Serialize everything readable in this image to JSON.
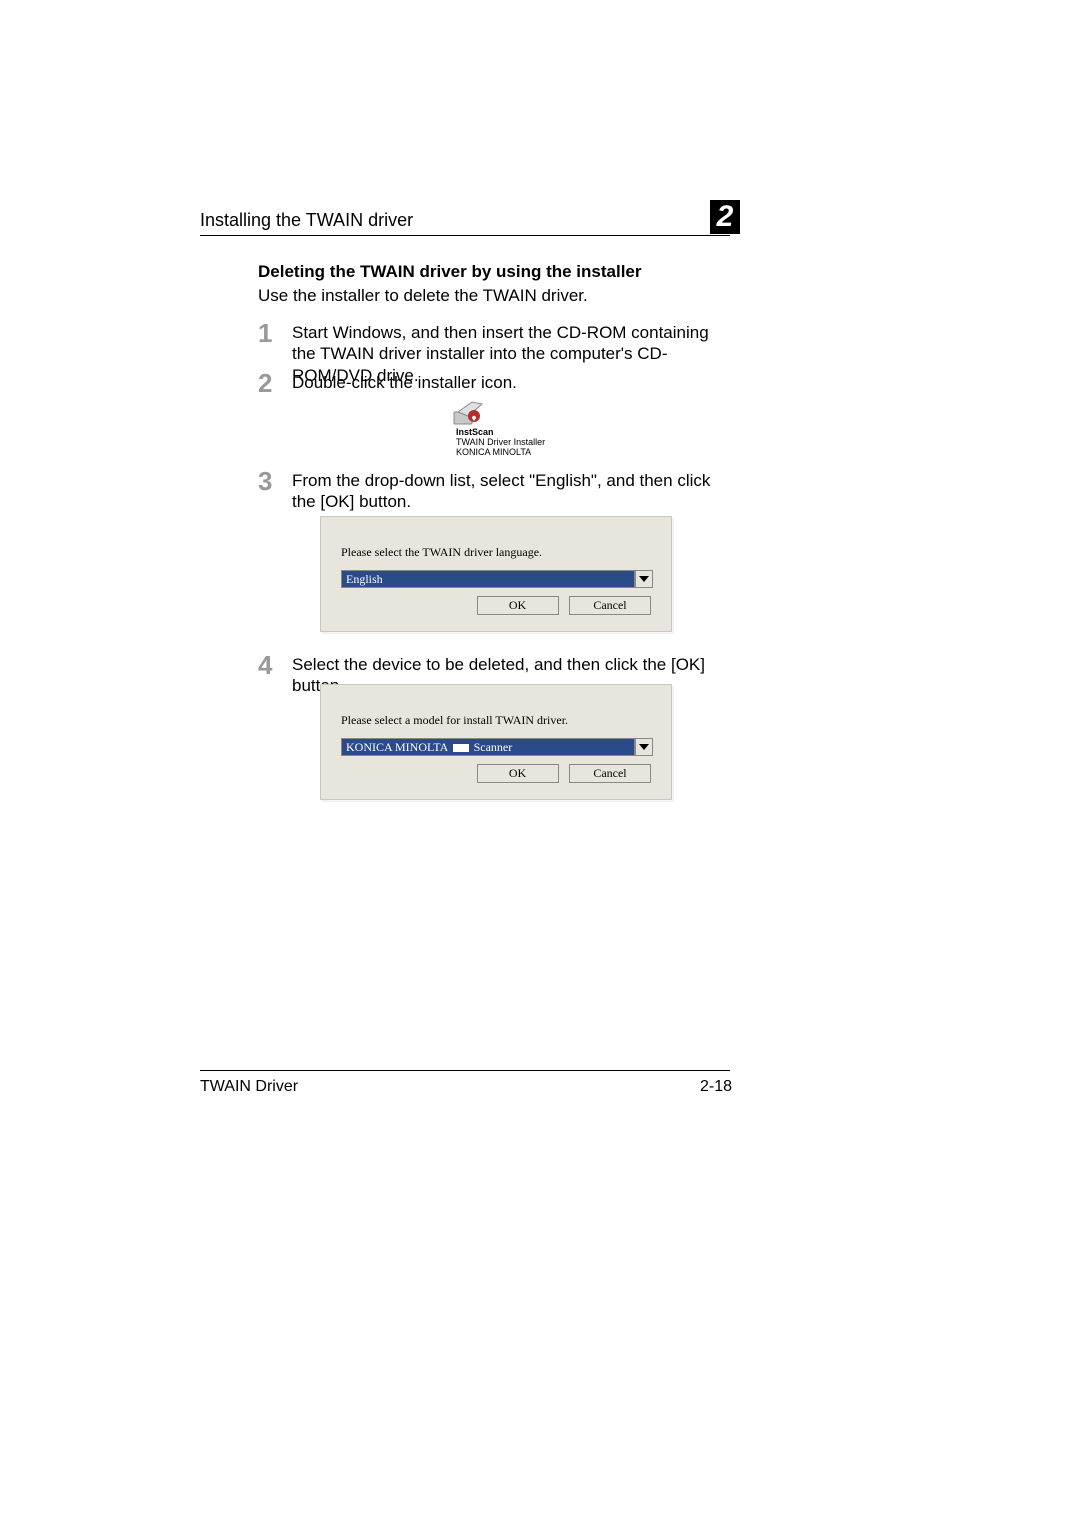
{
  "header": {
    "section_title": "Installing the TWAIN driver",
    "chapter_number": "2"
  },
  "section": {
    "heading": "Deleting the TWAIN driver by using the installer",
    "intro": "Use the installer to delete the TWAIN driver."
  },
  "steps": {
    "s1": {
      "num": "1",
      "text": "Start Windows, and then insert the CD-ROM containing the TWAIN driver installer into the computer's CD-ROM/DVD drive."
    },
    "s2": {
      "num": "2",
      "text": "Double-click the installer icon."
    },
    "s3": {
      "num": "3",
      "text": "From the drop-down list, select \"English\", and then click the [OK] button."
    },
    "s4": {
      "num": "4",
      "text": "Select the device to be deleted, and then click the [OK] button."
    }
  },
  "installer_icon": {
    "line1": "InstScan",
    "line2": "TWAIN Driver Installer",
    "line3": "KONICA MINOLTA"
  },
  "dialog1": {
    "label": "Please select the TWAIN driver language.",
    "value": "English",
    "ok": "OK",
    "cancel": "Cancel"
  },
  "dialog2": {
    "label": "Please select a model for install TWAIN driver.",
    "value_prefix": "KONICA MINOLTA",
    "value_suffix": "Scanner",
    "ok": "OK",
    "cancel": "Cancel"
  },
  "footer": {
    "left": "TWAIN Driver",
    "right": "2-18"
  }
}
